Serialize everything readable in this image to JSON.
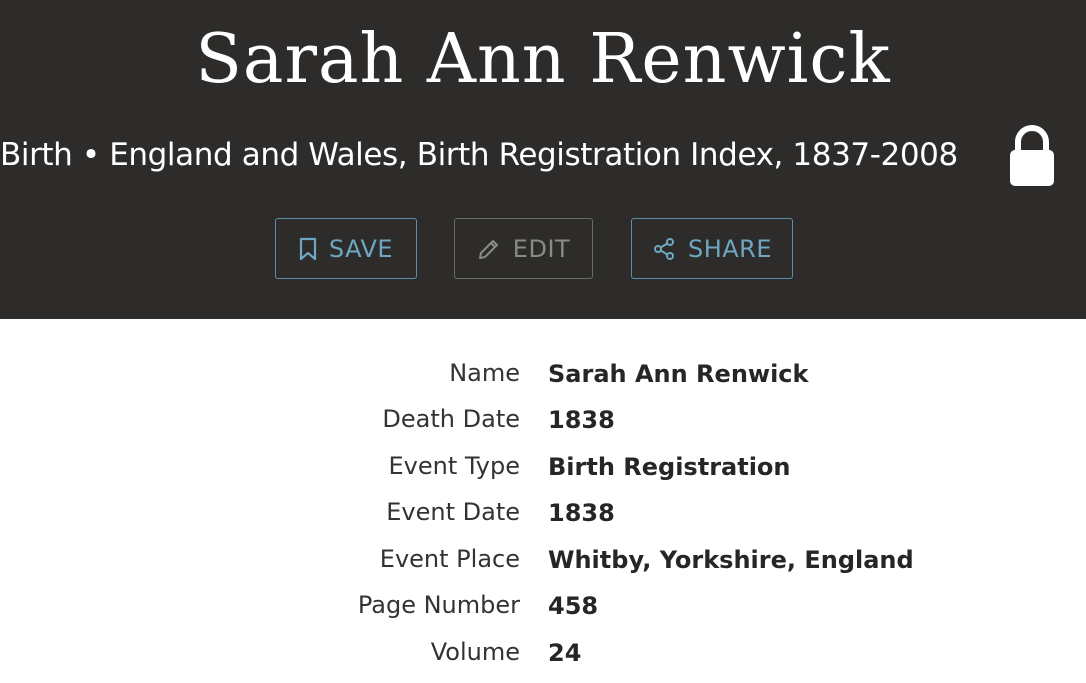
{
  "record": {
    "title": "Sarah Ann Renwick",
    "subtitle": "Birth • England and Wales, Birth Registration Index, 1837-2008"
  },
  "actions": {
    "save_label": "SAVE",
    "edit_label": "EDIT",
    "share_label": "SHARE"
  },
  "icons": {
    "lock": "lock-icon",
    "save": "bookmark-icon",
    "edit": "pencil-icon",
    "share": "share-icon"
  },
  "colors": {
    "header_bg": "#2d2c2a",
    "accent": "#6fa6c1",
    "disabled": "#8a8a88"
  },
  "details": [
    {
      "label": "Name",
      "value": "Sarah Ann Renwick"
    },
    {
      "label": "Death Date",
      "value": "1838"
    },
    {
      "label": "Event Type",
      "value": "Birth Registration"
    },
    {
      "label": "Event Date",
      "value": "1838"
    },
    {
      "label": "Event Place",
      "value": "Whitby, Yorkshire, England"
    },
    {
      "label": "Page Number",
      "value": "458"
    },
    {
      "label": "Volume",
      "value": "24"
    }
  ]
}
